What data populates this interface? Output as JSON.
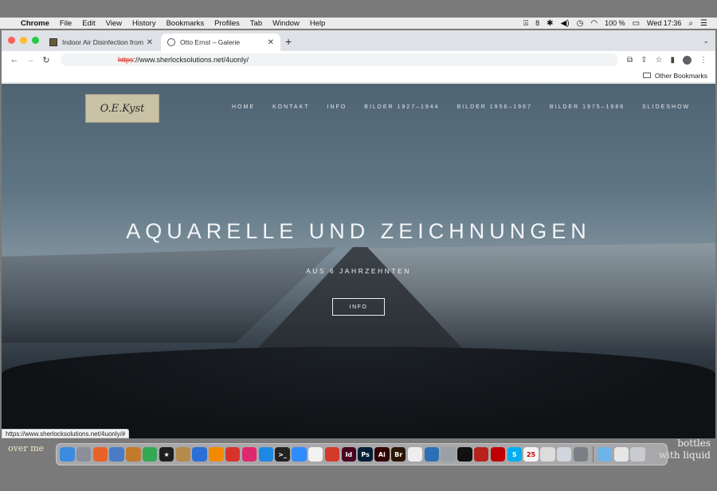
{
  "menubar": {
    "app_name": "Chrome",
    "items": [
      "File",
      "Edit",
      "View",
      "History",
      "Bookmarks",
      "Profiles",
      "Tab",
      "Window",
      "Help"
    ],
    "status": {
      "input_source": "8",
      "battery": "100 %",
      "clock": "Wed 17:36"
    }
  },
  "tabs": [
    {
      "title": "Indoor Air Disinfection from Wi",
      "active": false
    },
    {
      "title": "Otto Ernst – Galerie",
      "active": true
    }
  ],
  "address_bar": {
    "scheme": "https",
    "rest": "://www.sherlocksolutions.net/4uonly/"
  },
  "bookmarks_bar": {
    "other_bookmarks": "Other Bookmarks"
  },
  "site": {
    "logo_text": "O.E.Kyst",
    "nav": [
      "HOME",
      "KONTAKT",
      "INFO",
      "BILDER 1927–1944",
      "BILDER 1956–1967",
      "BILDER 1975–1986",
      "SLIDESHOW"
    ],
    "hero_title": "AQUARELLE UND ZEICHNUNGEN",
    "hero_subtitle": "AUS 6 JAHRZEHNTEN",
    "hero_button": "INFO"
  },
  "status_url": "https://www.sherlocksolutions.net/4uonly/#",
  "desktop": {
    "left_text": "over me",
    "right_line1": "bottles",
    "right_line2": "with liquid"
  },
  "dock": [
    {
      "name": "finder-icon",
      "color": "#3b8be0",
      "glyph": ""
    },
    {
      "name": "launchpad-icon",
      "color": "#8a8f99",
      "glyph": ""
    },
    {
      "name": "firefox-icon",
      "color": "#e8622a",
      "glyph": ""
    },
    {
      "name": "preview-icon",
      "color": "#4a7bc4",
      "glyph": ""
    },
    {
      "name": "guitar-icon",
      "color": "#c27a2c",
      "glyph": ""
    },
    {
      "name": "chrome-icon",
      "color": "#34a853",
      "glyph": ""
    },
    {
      "name": "star-icon",
      "color": "#1d1d1d",
      "glyph": "★"
    },
    {
      "name": "scripts-icon",
      "color": "#b58a4a",
      "glyph": ""
    },
    {
      "name": "browser-icon",
      "color": "#2b6fd6",
      "glyph": ""
    },
    {
      "name": "vlc-icon",
      "color": "#f28a00",
      "glyph": ""
    },
    {
      "name": "app-red-icon",
      "color": "#d8332b",
      "glyph": ""
    },
    {
      "name": "app-pink-icon",
      "color": "#e0286e",
      "glyph": ""
    },
    {
      "name": "safari-icon",
      "color": "#1e88e5",
      "glyph": ""
    },
    {
      "name": "terminal-icon",
      "color": "#222222",
      "glyph": ">_"
    },
    {
      "name": "zoom-icon",
      "color": "#2d8cff",
      "glyph": ""
    },
    {
      "name": "pages-icon",
      "color": "#f2f2f2",
      "glyph": ""
    },
    {
      "name": "app-flower-icon",
      "color": "#d23a2a",
      "glyph": ""
    },
    {
      "name": "indesign-icon",
      "color": "#49021f",
      "glyph": "Id"
    },
    {
      "name": "photoshop-icon",
      "color": "#001e36",
      "glyph": "Ps"
    },
    {
      "name": "illustrator-icon",
      "color": "#330000",
      "glyph": "Ai"
    },
    {
      "name": "bridge-icon",
      "color": "#2a1600",
      "glyph": "Br"
    },
    {
      "name": "acrobat-icon",
      "color": "#eeeeee",
      "glyph": ""
    },
    {
      "name": "app-wave-icon",
      "color": "#2d6fb7",
      "glyph": ""
    },
    {
      "name": "disk-utility-icon",
      "color": "#9aa0a6",
      "glyph": ""
    },
    {
      "name": "blackberry-icon",
      "color": "#111111",
      "glyph": ""
    },
    {
      "name": "git-icon",
      "color": "#b8221d",
      "glyph": ""
    },
    {
      "name": "filezilla-icon",
      "color": "#bf0000",
      "glyph": ""
    },
    {
      "name": "skype-icon",
      "color": "#00aff0",
      "glyph": "S"
    },
    {
      "name": "calendar-icon",
      "color": "#f5f5f5",
      "glyph": "25"
    },
    {
      "name": "photos-icon",
      "color": "#dcdcdc",
      "glyph": ""
    },
    {
      "name": "image-capture-icon",
      "color": "#cfd6de",
      "glyph": ""
    },
    {
      "name": "system-prefs-icon",
      "color": "#7b7f85",
      "glyph": ""
    },
    {
      "name": "downloads-folder-icon",
      "color": "#6fb3e8",
      "glyph": ""
    },
    {
      "name": "folder-stack-icon",
      "color": "#e6e6e6",
      "glyph": ""
    },
    {
      "name": "trash-icon",
      "color": "#c8ccd0",
      "glyph": ""
    }
  ]
}
